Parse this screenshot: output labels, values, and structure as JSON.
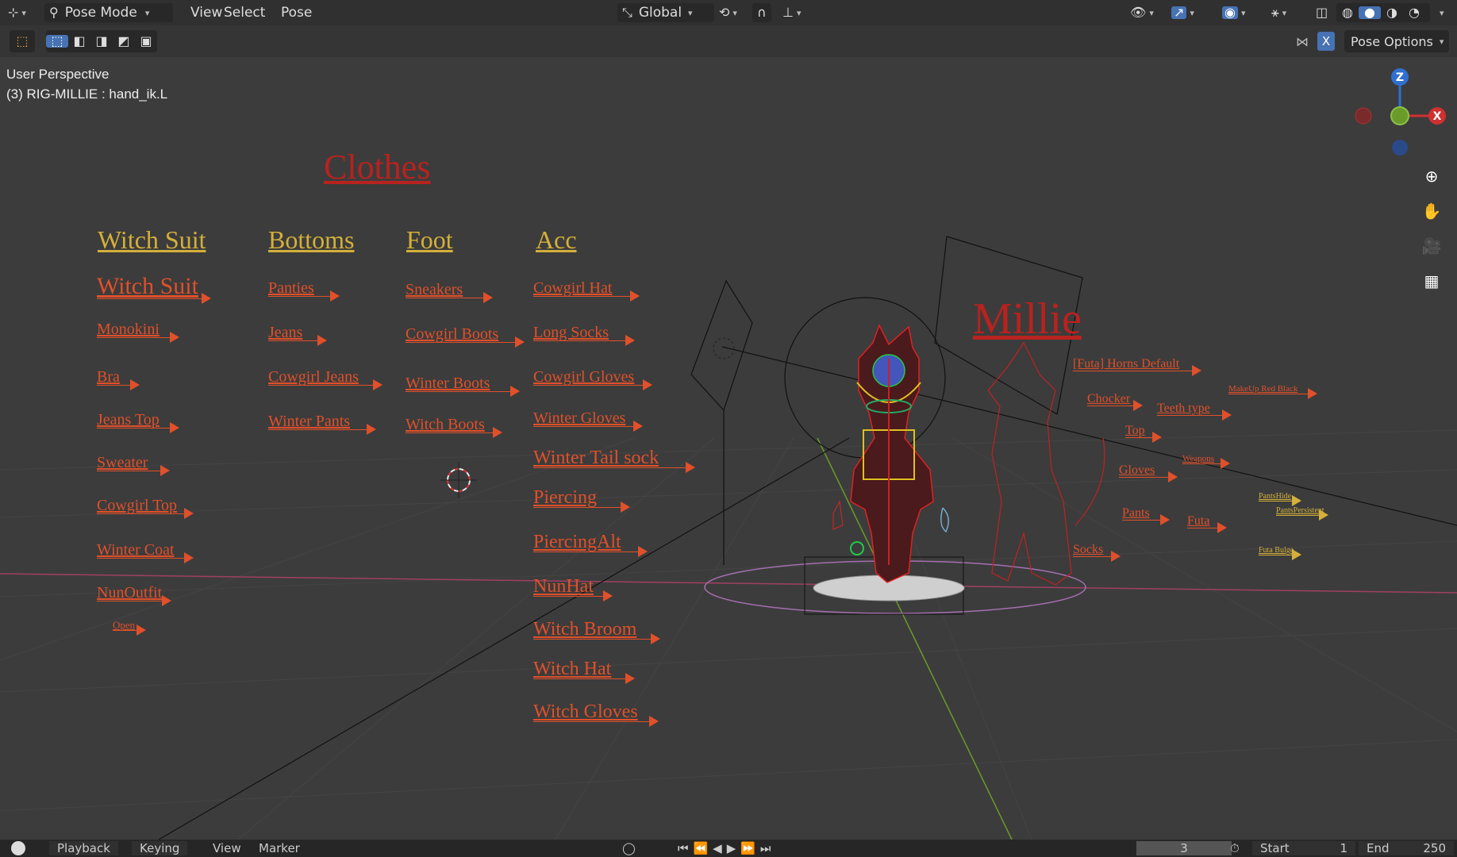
{
  "header": {
    "mode": "Pose Mode",
    "menus": [
      "View",
      "Select",
      "Pose"
    ],
    "transform_orientation": "Global",
    "x_mirror": "X",
    "pose_options": "Pose Options"
  },
  "overlay": {
    "view_name": "User Perspective",
    "active_object": "(3) RIG-MILLIE : hand_ik.L"
  },
  "gizmo": {
    "z": "Z",
    "x": "X"
  },
  "scene": {
    "clothes_title": "Clothes",
    "character_name": "Millie",
    "categories": [
      "Witch Suit",
      "Bottoms",
      "Foot",
      "Acc"
    ],
    "witch_suit_items": [
      "Witch Suit",
      "Monokini",
      "Bra",
      "Jeans Top",
      "Sweater",
      "Cowgirl Top",
      "Winter Coat",
      "NunOutfit",
      "Open"
    ],
    "bottoms_items": [
      "Panties",
      "Jeans",
      "Cowgirl Jeans",
      "Winter Pants"
    ],
    "foot_items": [
      "Sneakers",
      "Cowgirl Boots",
      "Winter Boots",
      "Witch Boots"
    ],
    "acc_items": [
      "Cowgirl Hat",
      "Long Socks",
      "Cowgirl Gloves",
      "Winter Gloves",
      "Winter Tail sock",
      "Piercing",
      "PiercingAlt",
      "NunHat",
      "Witch Broom",
      "Witch Hat",
      "Witch Gloves"
    ],
    "body_items": [
      "[Futa] Horns Default",
      "Chocker",
      "Teeth type",
      "Top",
      "Gloves",
      "Pants",
      "Futa",
      "Socks"
    ],
    "small_items": [
      "MakeUp Red Black",
      "Weapons",
      "PantsHide",
      "PantsPersistent",
      "Futa Bulge"
    ]
  },
  "timeline": {
    "menus": [
      "Playback",
      "Keying",
      "View",
      "Marker"
    ],
    "current_frame": "3",
    "start_label": "Start",
    "start_value": "1",
    "end_label": "End",
    "end_value": "250"
  },
  "colors": {
    "header_bg": "#303030",
    "viewport_bg": "#3c3c3c",
    "label_orange": "#e0502a",
    "category_yellow": "#d4b03a",
    "title_red": "#b8221f",
    "accent_blue": "#4772b3"
  }
}
